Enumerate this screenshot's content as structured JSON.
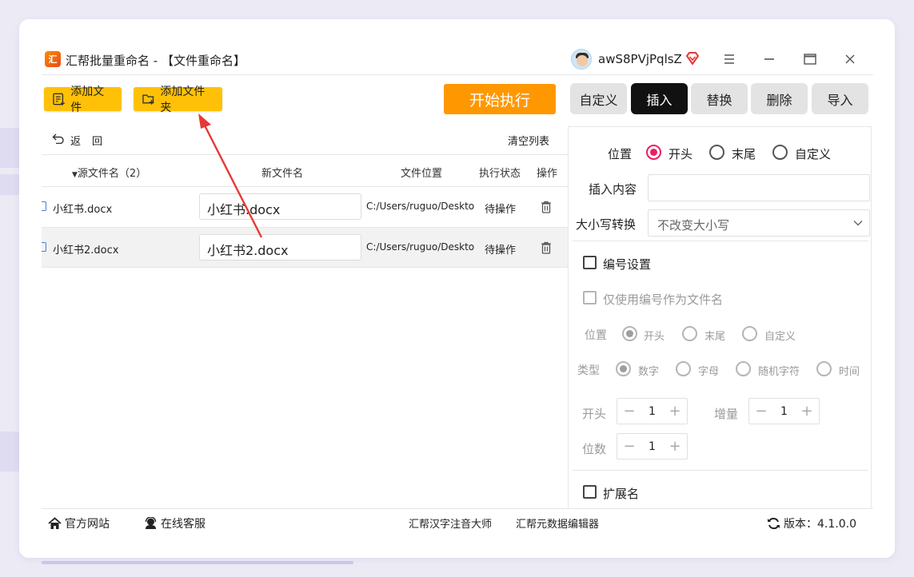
{
  "app": {
    "icon_text": "汇",
    "title": "汇帮批量重命名 - 【文件重命名】",
    "username": "awS8PVjPqlsZ"
  },
  "toolbar": {
    "add_file": "添加文件",
    "add_folder": "添加文件夹",
    "start": "开始执行"
  },
  "tabs": [
    "自定义",
    "插入",
    "替换",
    "删除",
    "导入"
  ],
  "active_tab": "插入",
  "list": {
    "back": "返",
    "back2": "回",
    "clear": "清空列表",
    "columns": {
      "source": "源文件名（2）",
      "new_name": "新文件名",
      "location": "文件位置",
      "status": "执行状态",
      "action": "操作"
    },
    "rows": [
      {
        "source": "小红书.docx",
        "new_name": "小红书.docx",
        "location": "C:/Users/ruguo/Deskto",
        "status": "待操作"
      },
      {
        "source": "小红书2.docx",
        "new_name": "小红书2.docx",
        "location": "C:/Users/ruguo/Deskto",
        "status": "待操作"
      }
    ]
  },
  "insert": {
    "position_label": "位置",
    "position_options": [
      "开头",
      "末尾",
      "自定义"
    ],
    "position_selected": "开头",
    "content_label": "插入内容",
    "content_value": "",
    "case_label": "大小写转换",
    "case_value": "不改变大小写"
  },
  "numbering": {
    "label": "编号设置",
    "checked": false,
    "only_number_label": "仅使用编号作为文件名",
    "position_label": "位置",
    "position_options": [
      "开头",
      "末尾",
      "自定义"
    ],
    "type_label": "类型",
    "type_options": [
      "数字",
      "字母",
      "随机字符",
      "时间"
    ],
    "start_label": "开头",
    "start_value": "1",
    "step_label": "增量",
    "step_value": "1",
    "digits_label": "位数",
    "digits_value": "1"
  },
  "extension": {
    "label": "扩展名",
    "checked": false
  },
  "statusbar": {
    "website": "官方网站",
    "support": "在线客服",
    "link1": "汇帮汉字注音大师",
    "link2": "汇帮元数据编辑器",
    "version": "版本：4.1.0.0"
  },
  "colors": {
    "accent_yellow": "#ffc107",
    "start_orange": "#ff9800",
    "radio_pink": "#e91e63",
    "annotation_red": "#e53935"
  }
}
